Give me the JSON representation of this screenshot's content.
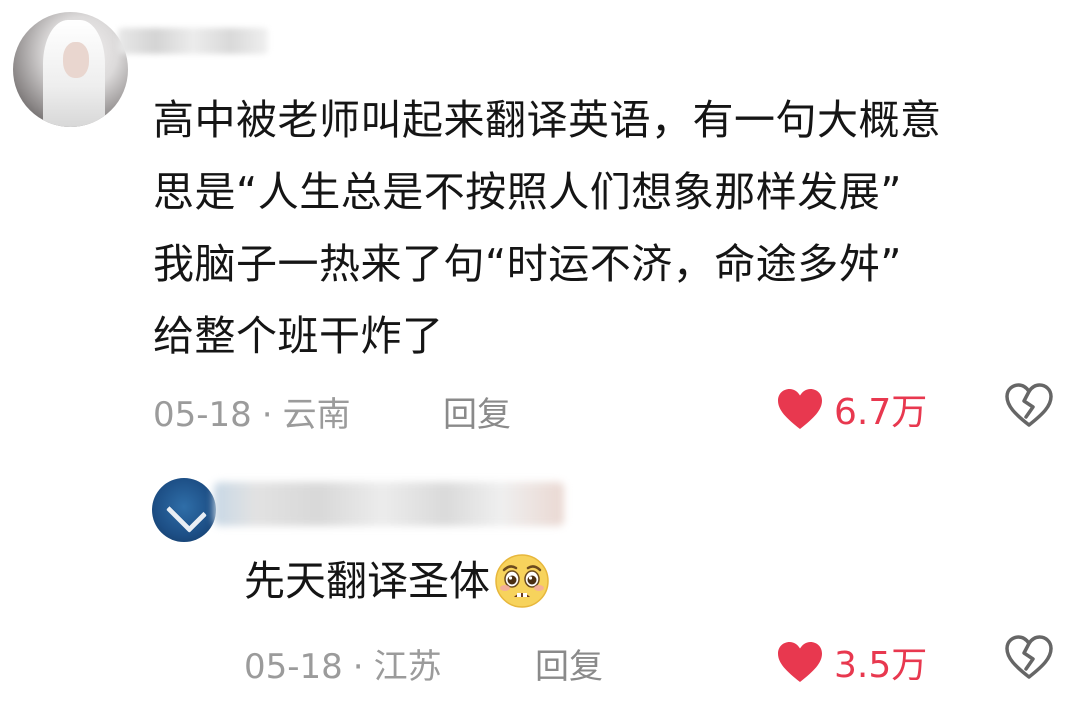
{
  "comment": {
    "lines": [
      "高中被老师叫起来翻译英语，有一句大概意",
      "思是“人生总是不按照人们想象那样发展”",
      "我脑子一热来了句“时运不济，命途多舛”",
      "给整个班干炸了"
    ],
    "date": "05-18",
    "separator": "·",
    "location": "云南",
    "reply_label": "回复",
    "likes": "6.7万"
  },
  "reply": {
    "text": "先天翻译圣体",
    "emoji": "pleading-face-emoji",
    "date": "05-18",
    "separator": "·",
    "location": "江苏",
    "reply_label": "回复",
    "likes": "3.5万"
  },
  "colors": {
    "like_red": "#e8384f",
    "meta_gray": "#9b9b9b",
    "text": "#151515"
  },
  "icons": {
    "like": "heart-icon",
    "dislike": "broken-heart-icon"
  }
}
